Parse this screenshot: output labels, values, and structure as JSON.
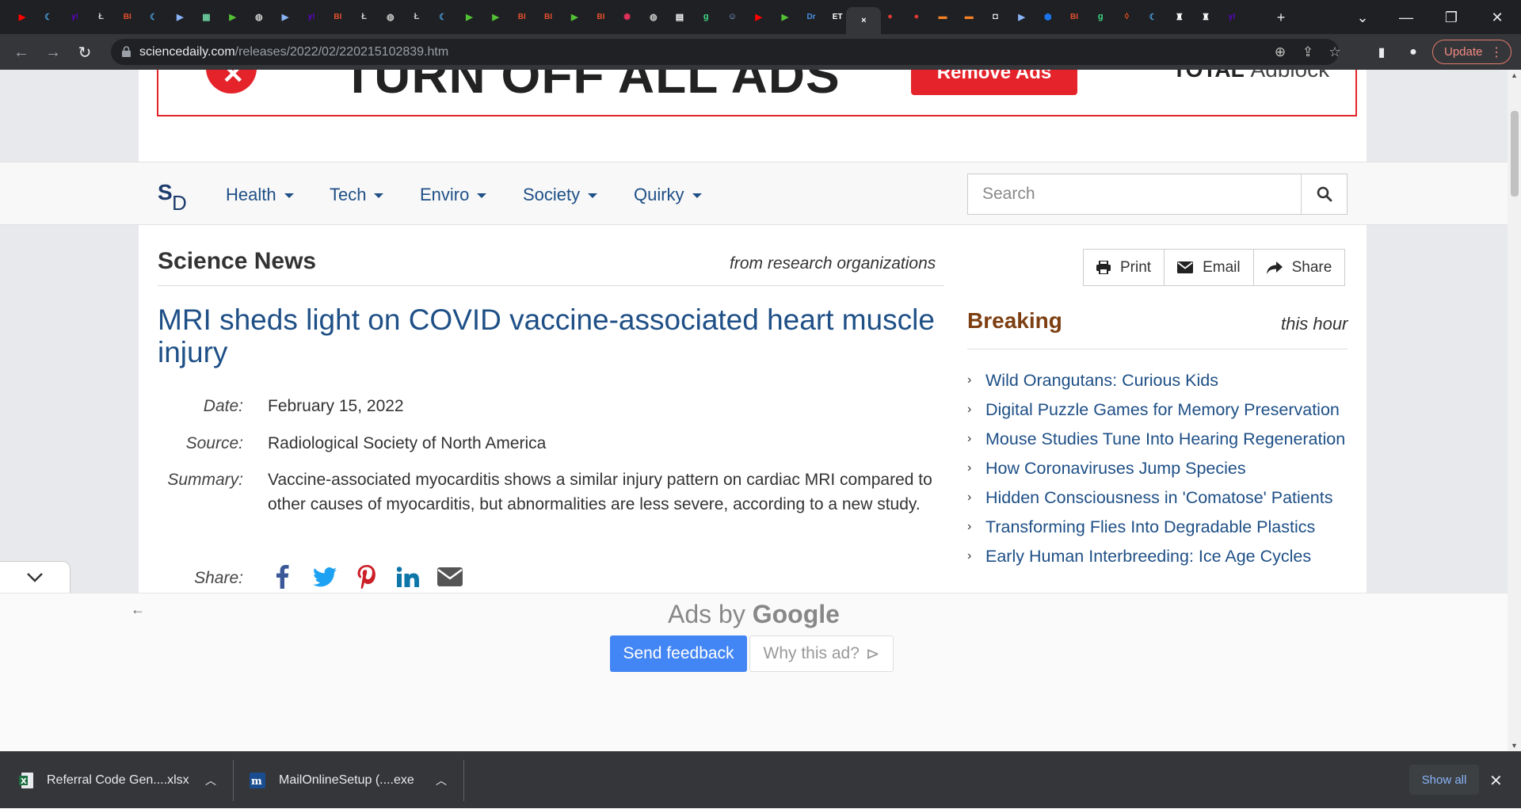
{
  "browser": {
    "address_bar": {
      "url_domain": "sciencedaily.com",
      "url_path": "/releases/2022/02/220215102839.htm"
    },
    "update_label": "Update",
    "active_tab_close": "×",
    "new_tab": "+",
    "tab_icons": [
      {
        "icon": "youtube-icon",
        "color": "#ff0000",
        "glyph": "▶"
      },
      {
        "icon": "crescent-icon",
        "color": "#4aa3df",
        "glyph": "☾"
      },
      {
        "icon": "yahoo-icon",
        "color": "#6001d2",
        "glyph": "y!"
      },
      {
        "icon": "script-icon",
        "color": "#cccccc",
        "glyph": "Ł"
      },
      {
        "icon": "bi-icon",
        "color": "#e4502f",
        "glyph": "BI"
      },
      {
        "icon": "crescent-icon",
        "color": "#4aa3df",
        "glyph": "☾"
      },
      {
        "icon": "flag-icon",
        "color": "#8ab4f8",
        "glyph": "▶"
      },
      {
        "icon": "map-icon",
        "color": "#6ccfa0",
        "glyph": "▦"
      },
      {
        "icon": "play-icon",
        "color": "#52c234",
        "glyph": "▶"
      },
      {
        "icon": "globe-icon",
        "color": "#cccccc",
        "glyph": "◍"
      },
      {
        "icon": "flag-icon",
        "color": "#8ab4f8",
        "glyph": "▶"
      },
      {
        "icon": "yahoo-icon",
        "color": "#6001d2",
        "glyph": "y!"
      },
      {
        "icon": "bi-icon",
        "color": "#e4502f",
        "glyph": "BI"
      },
      {
        "icon": "script-icon",
        "color": "#cccccc",
        "glyph": "Ł"
      },
      {
        "icon": "globe-icon",
        "color": "#cccccc",
        "glyph": "◍"
      },
      {
        "icon": "script-icon",
        "color": "#cccccc",
        "glyph": "Ł"
      },
      {
        "icon": "crescent-icon",
        "color": "#4aa3df",
        "glyph": "☾"
      },
      {
        "icon": "play-icon",
        "color": "#52c234",
        "glyph": "▶"
      },
      {
        "icon": "play-icon",
        "color": "#52c234",
        "glyph": "▶"
      },
      {
        "icon": "bi-icon",
        "color": "#e4502f",
        "glyph": "BI"
      },
      {
        "icon": "bi-icon",
        "color": "#e4502f",
        "glyph": "BI"
      },
      {
        "icon": "play-icon",
        "color": "#52c234",
        "glyph": "▶"
      },
      {
        "icon": "bi-icon",
        "color": "#e4502f",
        "glyph": "BI"
      },
      {
        "icon": "burst-icon",
        "color": "#e0315b",
        "glyph": "✺"
      },
      {
        "icon": "globe-icon",
        "color": "#cccccc",
        "glyph": "◍"
      },
      {
        "icon": "news-icon",
        "color": "#ffffff",
        "glyph": "▤"
      },
      {
        "icon": "g-icon",
        "color": "#3ddc84",
        "glyph": "g"
      },
      {
        "icon": "portrait-icon",
        "color": "#8ab4f8",
        "glyph": "☺"
      },
      {
        "icon": "youtube-icon",
        "color": "#ff0000",
        "glyph": "▶"
      },
      {
        "icon": "play-icon",
        "color": "#52c234",
        "glyph": "▶"
      },
      {
        "icon": "dr-icon",
        "color": "#4a90e2",
        "glyph": "Dr"
      },
      {
        "icon": "et-icon",
        "color": "#ffffff",
        "glyph": "ET"
      },
      {
        "icon": "active-close-icon",
        "color": "#ffffff",
        "glyph": "×"
      },
      {
        "icon": "mic-icon",
        "color": "#e53935",
        "glyph": "●"
      },
      {
        "icon": "mic-icon",
        "color": "#e53935",
        "glyph": "●"
      },
      {
        "icon": "bookmark-icon",
        "color": "#f48024",
        "glyph": "▬"
      },
      {
        "icon": "bookmark-icon",
        "color": "#f48024",
        "glyph": "▬"
      },
      {
        "icon": "square-icon",
        "color": "#ffffff",
        "glyph": "◘"
      },
      {
        "icon": "flag-icon",
        "color": "#8ab4f8",
        "glyph": "▶"
      },
      {
        "icon": "hex-icon",
        "color": "#1a73e8",
        "glyph": "⬢"
      },
      {
        "icon": "bi-icon",
        "color": "#e4502f",
        "glyph": "BI"
      },
      {
        "icon": "g-icon",
        "color": "#3ddc84",
        "glyph": "g"
      },
      {
        "icon": "shield-icon",
        "color": "#f4511e",
        "glyph": "◊"
      },
      {
        "icon": "crescent-icon",
        "color": "#4aa3df",
        "glyph": "☾"
      },
      {
        "icon": "crest-icon",
        "color": "#ffffff",
        "glyph": "♜"
      },
      {
        "icon": "crest-icon",
        "color": "#ffffff",
        "glyph": "♜"
      },
      {
        "icon": "yahoo-icon",
        "color": "#6001d2",
        "glyph": "y!"
      }
    ]
  },
  "ad_banner": {
    "headline": "TURN OFF ALL ADS",
    "button_label": "Remove Ads",
    "brand_bold": "TOTAL",
    "brand_rest": "Adblock"
  },
  "site_nav": {
    "logo_s": "S",
    "logo_d": "D",
    "items": [
      {
        "label": "Health"
      },
      {
        "label": "Tech"
      },
      {
        "label": "Enviro"
      },
      {
        "label": "Society"
      },
      {
        "label": "Quirky"
      }
    ],
    "search_placeholder": "Search"
  },
  "article": {
    "section": "Science News",
    "section_sub": "from research organizations",
    "title": "MRI sheds light on COVID vaccine-associated heart muscle injury",
    "date_label": "Date:",
    "date": "February 15, 2022",
    "source_label": "Source:",
    "source": "Radiological Society of North America",
    "summary_label": "Summary:",
    "summary": "Vaccine-associated myocarditis shows a similar injury pattern on cardiac MRI compared to other causes of myocarditis, but abnormalities are less severe, according to a new study.",
    "share_label": "Share:",
    "share_icons": [
      "facebook-icon",
      "twitter-icon",
      "pinterest-icon",
      "linkedin-icon",
      "email-icon"
    ]
  },
  "actions": {
    "print": "Print",
    "email": "Email",
    "share": "Share"
  },
  "breaking": {
    "title": "Breaking",
    "subtitle": "this hour",
    "items": [
      "Wild Orangutans: Curious Kids",
      "Digital Puzzle Games for Memory Preservation",
      "Mouse Studies Tune Into Hearing Regeneration",
      "How Coronaviruses Jump Species",
      "Hidden Consciousness in 'Comatose' Patients",
      "Transforming Flies Into Degradable Plastics",
      "Early Human Interbreeding: Ice Age Cycles"
    ]
  },
  "google_ads": {
    "ads_by": "Ads by",
    "google": "Google",
    "send_feedback": "Send feedback",
    "why_this_ad": "Why this ad?"
  },
  "downloads": {
    "items": [
      {
        "name": "Referral Code Gen....xlsx",
        "icon": "excel-icon"
      },
      {
        "name": "MailOnlineSetup (....exe",
        "icon": "mailonline-icon"
      }
    ],
    "show_all": "Show all"
  },
  "colors": {
    "link_blue": "#1e4f86",
    "breaking_brown": "#7d3f12",
    "ad_red": "#e5232b",
    "google_blue": "#4285f4"
  }
}
